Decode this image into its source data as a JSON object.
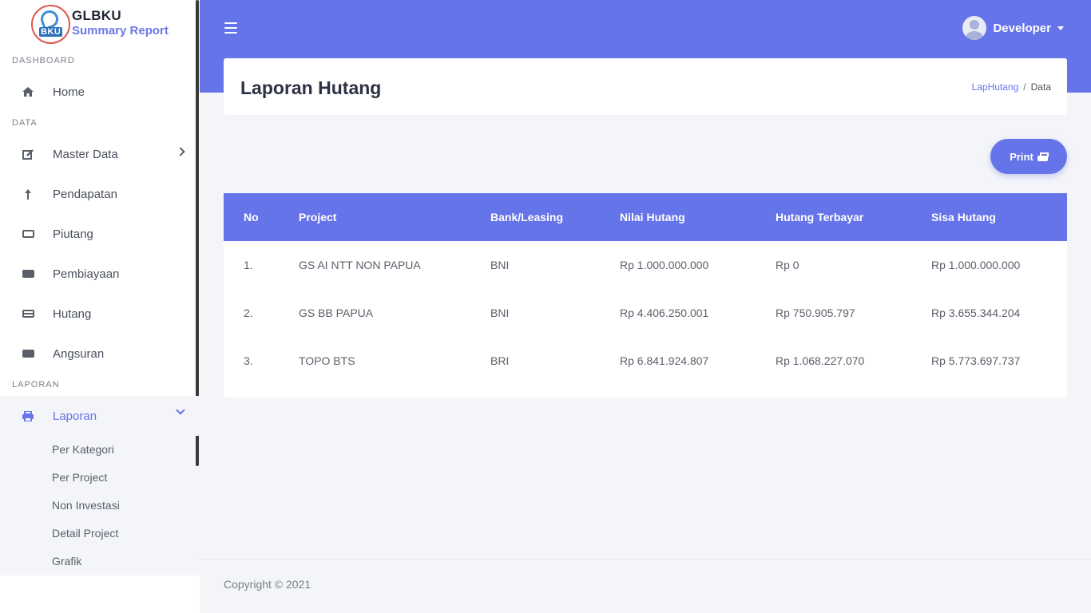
{
  "brand": {
    "title": "GLBKU",
    "subtitle": "Summary Report",
    "logo_text": "BKU"
  },
  "sidebar": {
    "sections": [
      "DASHBOARD",
      "DATA",
      "LAPORAN"
    ],
    "items": [
      {
        "label": "Home",
        "icon": "home-icon"
      },
      {
        "label": "Master Data",
        "icon": "edit-icon"
      },
      {
        "label": "Pendapatan",
        "icon": "arrow-up-icon"
      },
      {
        "label": "Piutang",
        "icon": "money-bill-icon"
      },
      {
        "label": "Pembiayaan",
        "icon": "money-bill-filled-icon"
      },
      {
        "label": "Hutang",
        "icon": "credit-card-icon"
      },
      {
        "label": "Angsuran",
        "icon": "money-check-icon"
      },
      {
        "label": "Laporan",
        "icon": "print-icon"
      }
    ],
    "sub_items": [
      "Per Kategori",
      "Per Project",
      "Non Investasi",
      "Detail Project",
      "Grafik"
    ]
  },
  "topbar": {
    "user_name": "Developer"
  },
  "page": {
    "title": "Laporan Hutang",
    "breadcrumb": {
      "link": "LapHutang",
      "separator": "/",
      "current": "Data"
    },
    "print_label": "Print"
  },
  "table": {
    "headers": [
      "No",
      "Project",
      "Bank/Leasing",
      "Nilai Hutang",
      "Hutang Terbayar",
      "Sisa Hutang"
    ],
    "rows": [
      [
        "1.",
        "GS AI NTT NON PAPUA",
        "BNI",
        "Rp 1.000.000.000",
        "Rp 0",
        "Rp 1.000.000.000"
      ],
      [
        "2.",
        "GS BB PAPUA",
        "BNI",
        "Rp 4.406.250.001",
        "Rp 750.905.797",
        "Rp 3.655.344.204"
      ],
      [
        "3.",
        "TOPO BTS",
        "BRI",
        "Rp 6.841.924.807",
        "Rp 1.068.227.070",
        "Rp 5.773.697.737"
      ]
    ]
  },
  "footer": {
    "copyright": "Copyright © 2021"
  },
  "colors": {
    "accent": "#6674e9",
    "sidebar_bg": "#ffffff",
    "content_bg": "#f4f5f9"
  }
}
